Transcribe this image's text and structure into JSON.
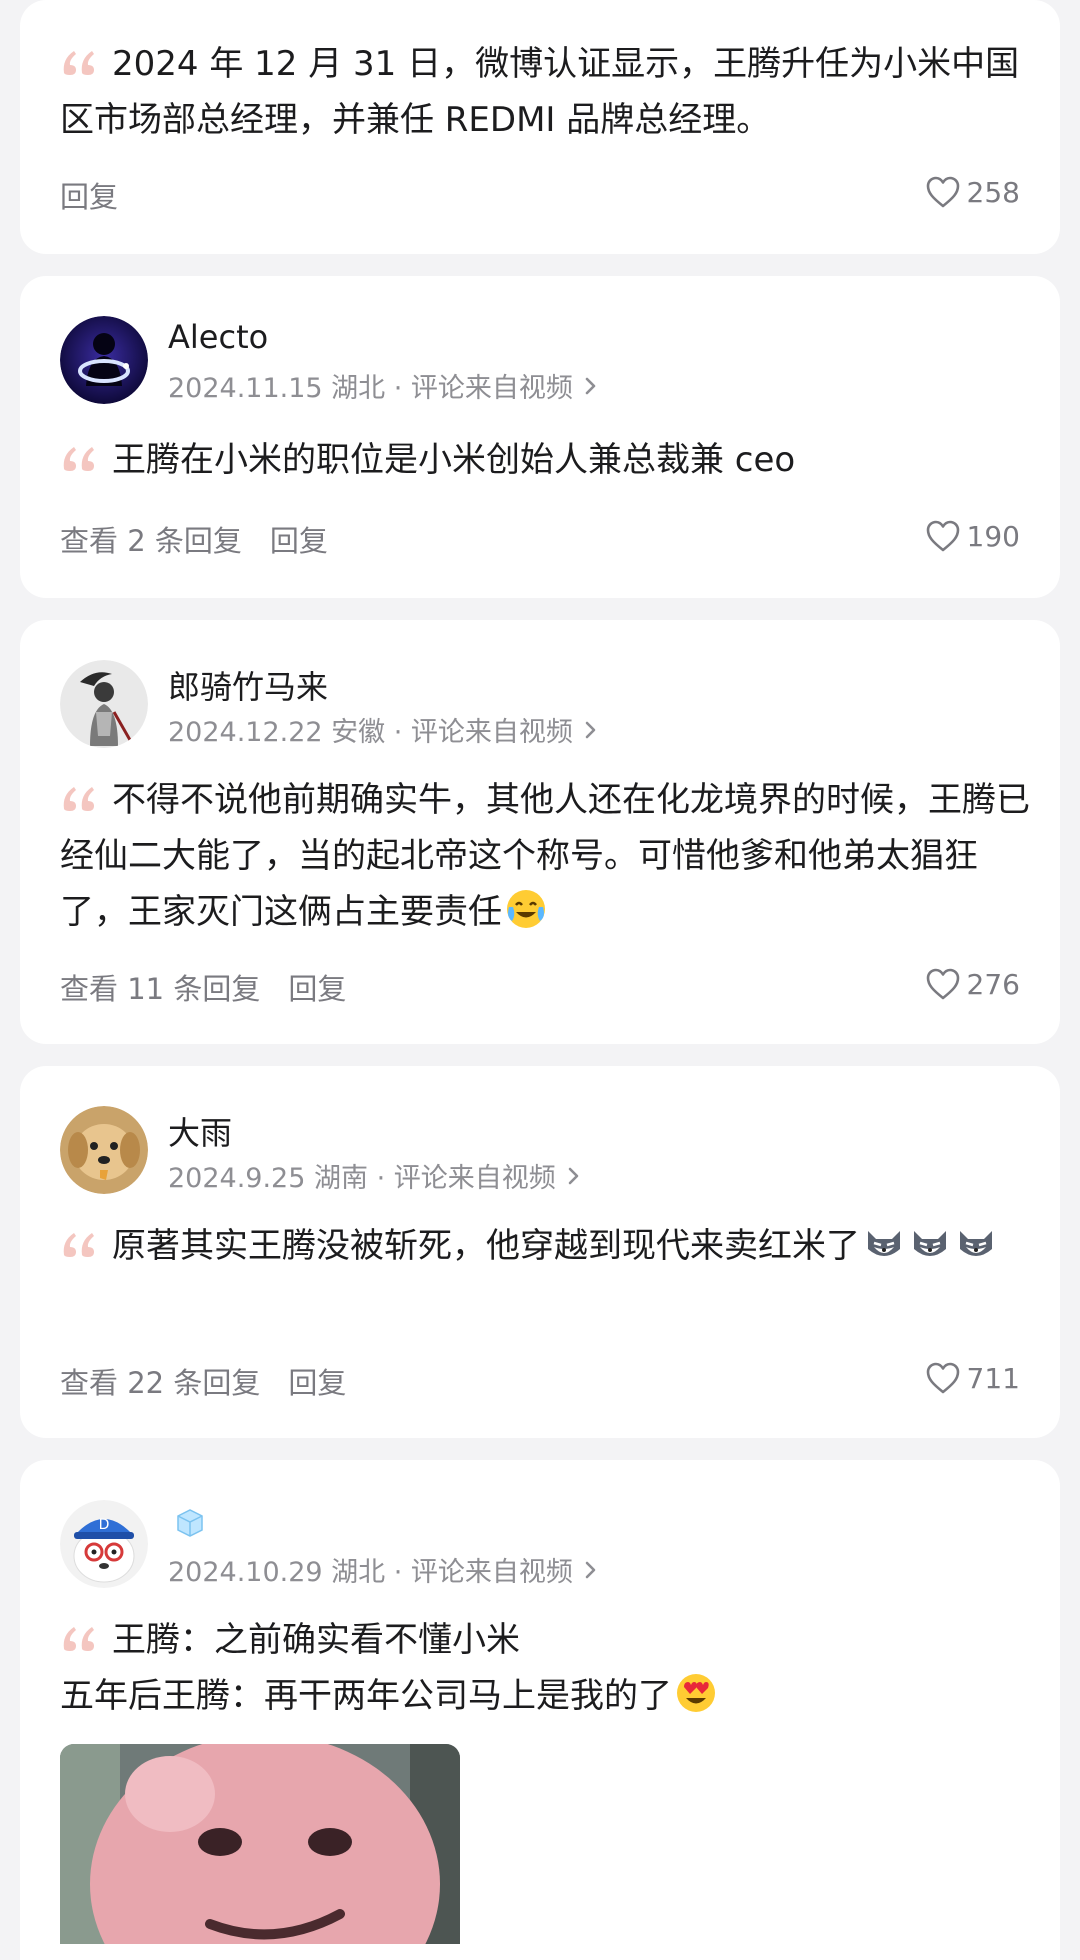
{
  "comments": [
    {
      "text": "2024 年 12 月 31 日，微博认证显示，王腾升任为小米中国区市场部总经理，并兼任 REDMI 品牌总经理。",
      "reply_label": "回复",
      "likes": "258"
    },
    {
      "username": "Alecto",
      "meta": "2024.11.15 湖北 · 评论来自视频",
      "text": "王腾在小米的职位是小米创始人兼总裁兼 ceo",
      "view_replies": "查看 2 条回复",
      "reply_label": "回复",
      "likes": "190"
    },
    {
      "username": "郎骑竹马来",
      "meta": "2024.12.22 安徽 · 评论来自视频",
      "text": "不得不说他前期确实牛，其他人还在化龙境界的时候，王腾已经仙二大能了，当的起北帝这个称号。可惜他爹和他弟太猖狂了，王家灭门这俩占主要责任",
      "view_replies": "查看 11 条回复",
      "reply_label": "回复",
      "likes": "276"
    },
    {
      "username": "大雨",
      "meta": "2024.9.25 湖南 · 评论来自视频",
      "text": "原著其实王腾没被斩死，他穿越到现代来卖红米了",
      "view_replies": "查看 22 条回复",
      "reply_label": "回复",
      "likes": "711"
    },
    {
      "meta": "2024.10.29 湖北 · 评论来自视频",
      "text_line1": "王腾：之前确实看不懂小米",
      "text_line2": "五年后王腾：再干两年公司马上是我的了"
    }
  ],
  "icons": {
    "heart": "heart-outline-icon",
    "chevron": "chevron-right-icon",
    "quote": "quote-mark-icon",
    "emoji_crying": "crying-laughing-emoji",
    "emoji_wolf": "wolf-emoji",
    "emoji_heart_eyes": "heart-eyes-emoji",
    "badge_ice": "ice-cube-icon"
  },
  "colors": {
    "background": "#f3f3f5",
    "card": "#ffffff",
    "secondary_text": "#8e8e93",
    "quote_mark": "#f4c6c0"
  }
}
